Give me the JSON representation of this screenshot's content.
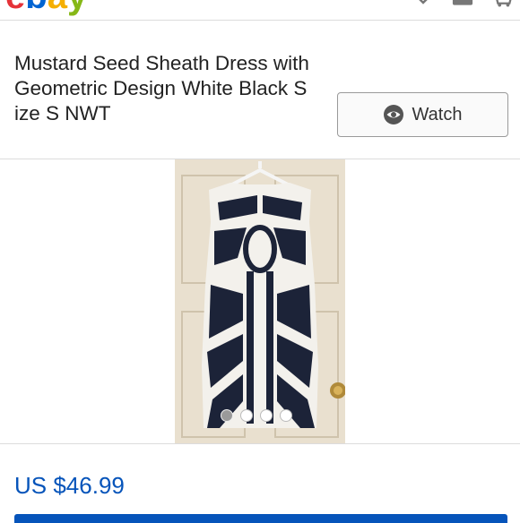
{
  "header": {
    "logo_letters": [
      {
        "char": "e",
        "color": "#e53238"
      },
      {
        "char": "b",
        "color": "#0064d2"
      },
      {
        "char": "a",
        "color": "#f5af02"
      },
      {
        "char": "y",
        "color": "#86b817"
      }
    ],
    "icons": [
      "chevron-down-icon",
      "notification-icon",
      "cart-icon"
    ]
  },
  "listing": {
    "title": "Mustard Seed Sheath Dress with Geometric Design White Black Size S NWT",
    "watch_label": "Watch",
    "price": "US $46.99"
  },
  "gallery": {
    "image_count": 4,
    "active_index": 0,
    "image_subject": "dress-photo"
  },
  "colors": {
    "price_blue": "#0654ba",
    "border_gray": "#dcdcdc"
  }
}
